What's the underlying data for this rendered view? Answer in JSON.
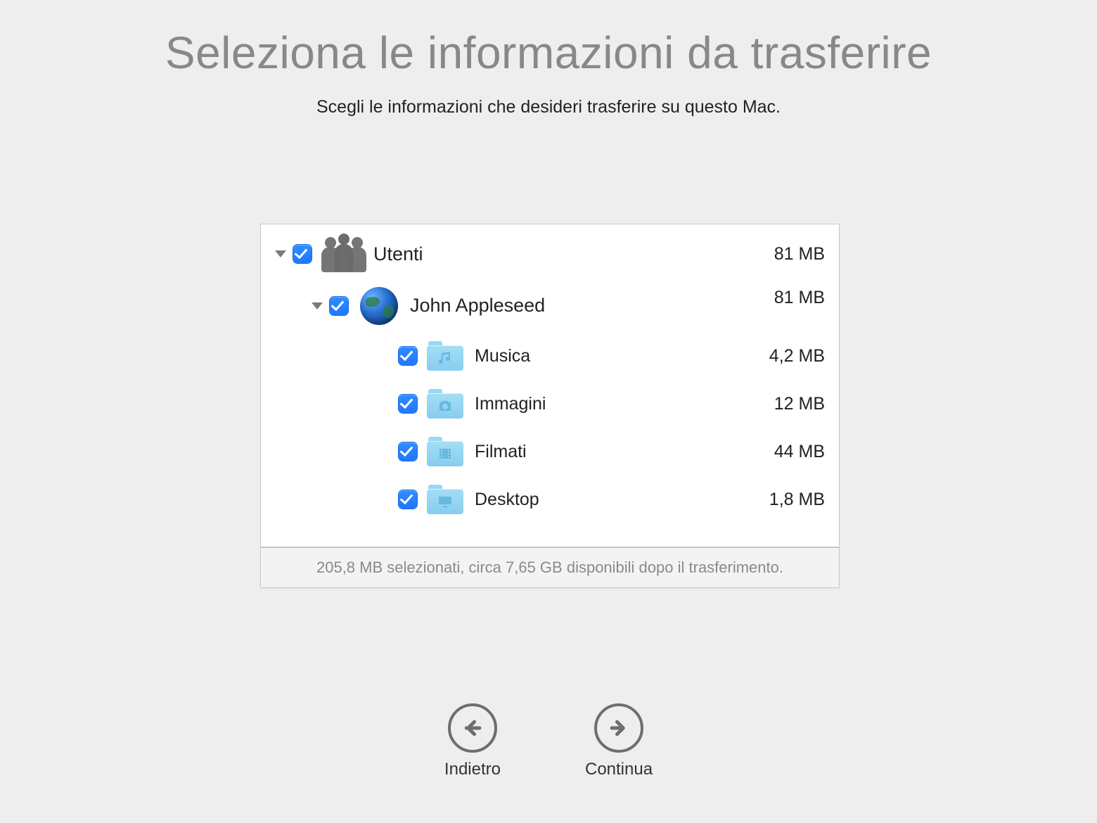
{
  "title": "Seleziona le informazioni da trasferire",
  "subtitle": "Scegli le informazioni che desideri trasferire su questo Mac.",
  "tree": {
    "root": {
      "label": "Utenti",
      "size": "81 MB"
    },
    "user": {
      "label": "John Appleseed",
      "size": "81 MB"
    },
    "items": [
      {
        "icon": "music",
        "label": "Musica",
        "size": "4,2 MB"
      },
      {
        "icon": "photos",
        "label": "Immagini",
        "size": "12 MB"
      },
      {
        "icon": "movies",
        "label": "Filmati",
        "size": "44 MB"
      },
      {
        "icon": "desktop",
        "label": "Desktop",
        "size": "1,8 MB"
      }
    ]
  },
  "status": "205,8 MB selezionati, circa 7,65 GB disponibili dopo il trasferimento.",
  "nav": {
    "back": "Indietro",
    "continue": "Continua"
  }
}
